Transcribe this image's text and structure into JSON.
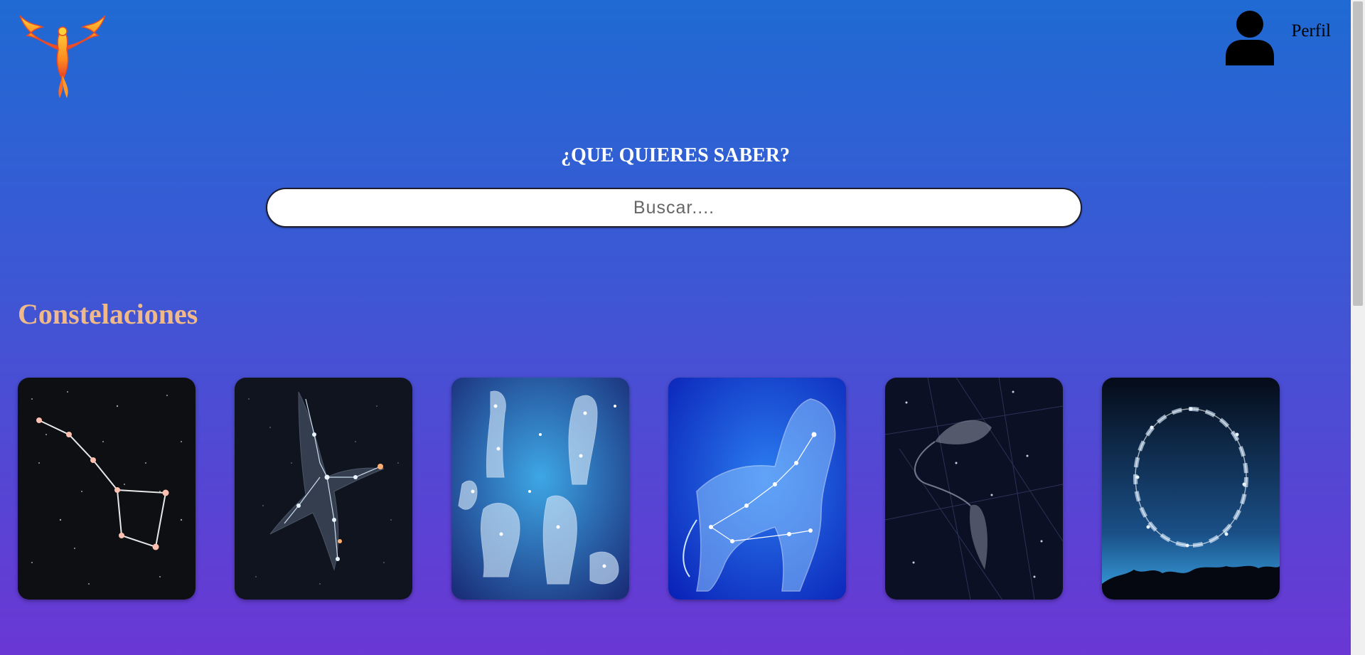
{
  "header": {
    "logo_icon": "phoenix-logo-icon",
    "profile_icon": "user-silhouette-icon",
    "profile_label": "Perfil"
  },
  "hero": {
    "title": "¿QUE QUIERES SABER?",
    "search_placeholder": "Buscar....",
    "search_value": ""
  },
  "section": {
    "title": "Constelaciones",
    "title_color": "#f0b98a"
  },
  "cards": [
    {
      "image": "big-dipper-constellation"
    },
    {
      "image": "eagle-constellation"
    },
    {
      "image": "zodiac-figures-constellation"
    },
    {
      "image": "leo-lion-constellation"
    },
    {
      "image": "pisces-constellation"
    },
    {
      "image": "zodiac-circle-constellation"
    }
  ],
  "colors": {
    "background_top": "#1f6ad3",
    "background_bottom": "#6a37d4",
    "title": "#ffffff"
  }
}
